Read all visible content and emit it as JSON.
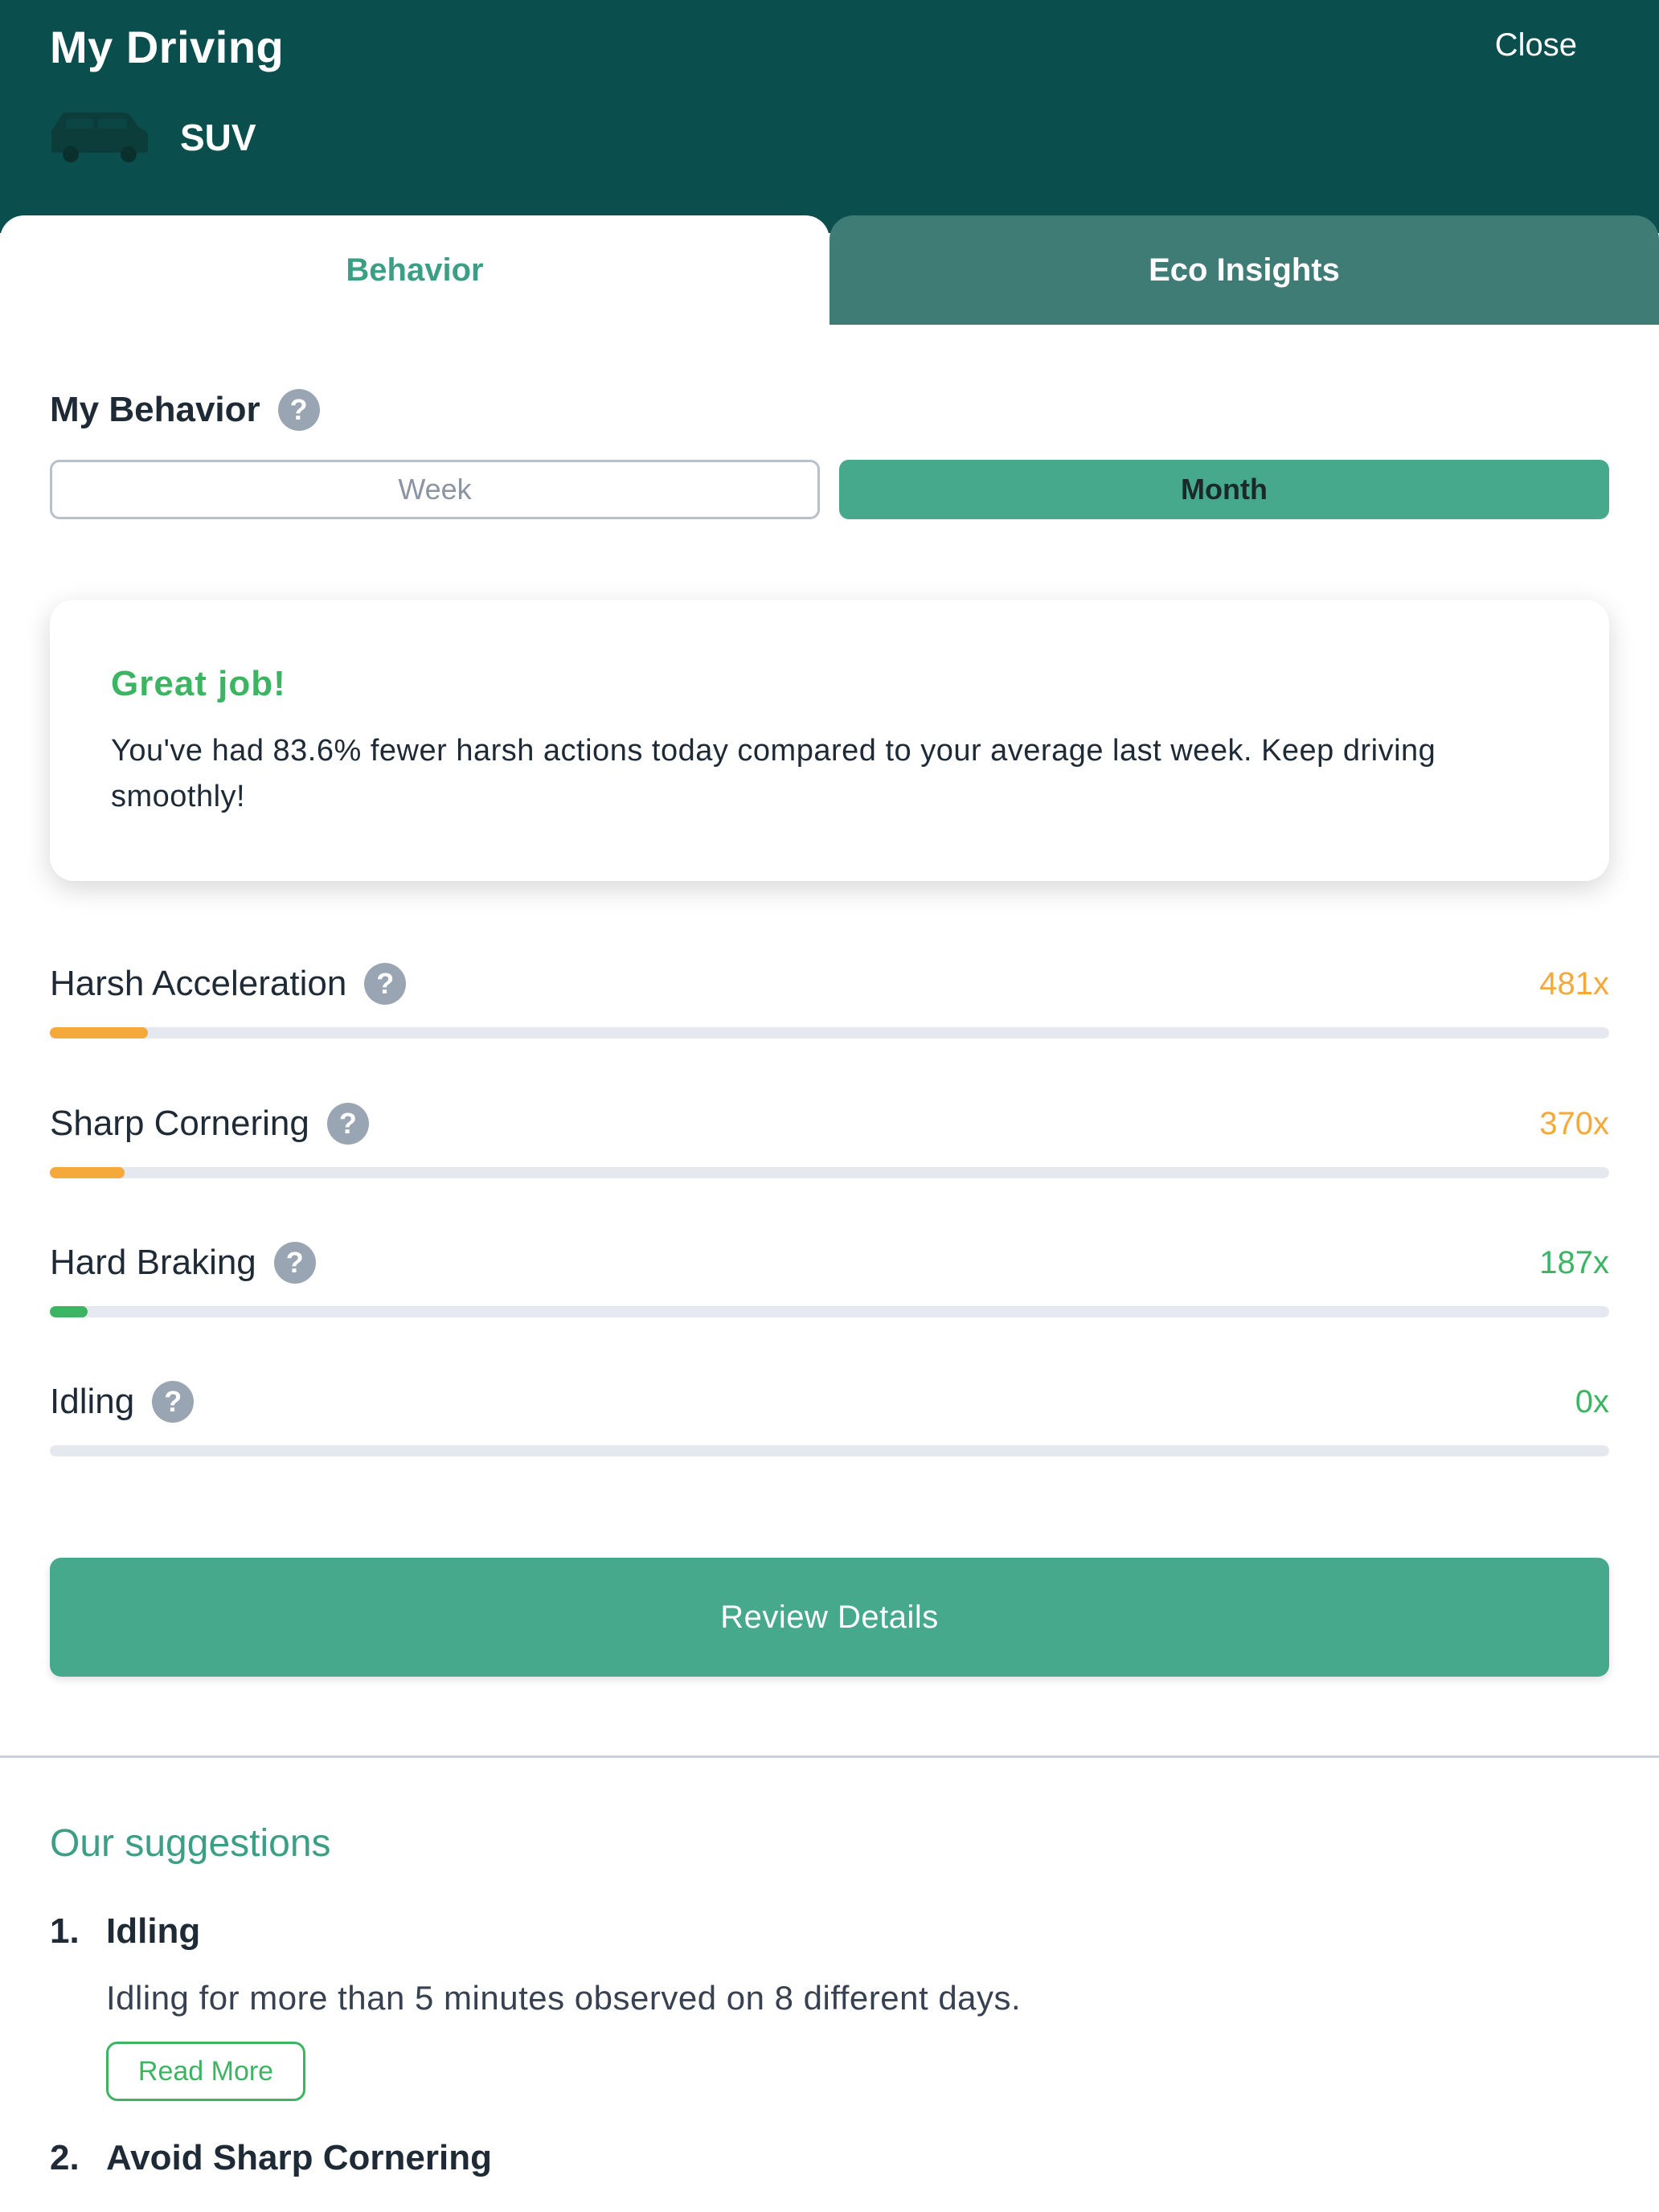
{
  "header": {
    "title": "My Driving",
    "close_label": "Close",
    "vehicle": {
      "icon": "car-icon",
      "label": "SUV"
    }
  },
  "tabs": [
    {
      "label": "Behavior",
      "active": true
    },
    {
      "label": "Eco Insights",
      "active": false
    }
  ],
  "behavior": {
    "section_title": "My Behavior",
    "period_options": [
      {
        "label": "Week",
        "selected": false
      },
      {
        "label": "Month",
        "selected": true
      }
    ],
    "card": {
      "title": "Great job!",
      "body": "You've had 83.6% fewer harsh actions today compared to your average last week. Keep driving smoothly!"
    },
    "metrics": [
      {
        "label": "Harsh Acceleration",
        "value": "481x",
        "level_fraction": 0.063,
        "color": "#f5a93a"
      },
      {
        "label": "Sharp Cornering",
        "value": "370x",
        "level_fraction": 0.048,
        "color": "#f5a93a"
      },
      {
        "label": "Hard Braking",
        "value": "187x",
        "level_fraction": 0.024,
        "color": "#3cb563"
      },
      {
        "label": "Idling",
        "value": "0x",
        "level_fraction": 0,
        "color": "#3cb563"
      }
    ],
    "review_button_label": "Review Details"
  },
  "suggestions": {
    "title": "Our suggestions",
    "items": [
      {
        "number": "1.",
        "title": "Idling",
        "description": "Idling for more than 5 minutes observed on 8 different days.",
        "read_more_label": "Read More"
      },
      {
        "number": "2.",
        "title": "Avoid Sharp Cornering"
      }
    ]
  },
  "colors": {
    "header_bg": "#0a4f4d",
    "accent": "#46a98b",
    "positive": "#3cb563",
    "warning": "#f5a93a"
  }
}
